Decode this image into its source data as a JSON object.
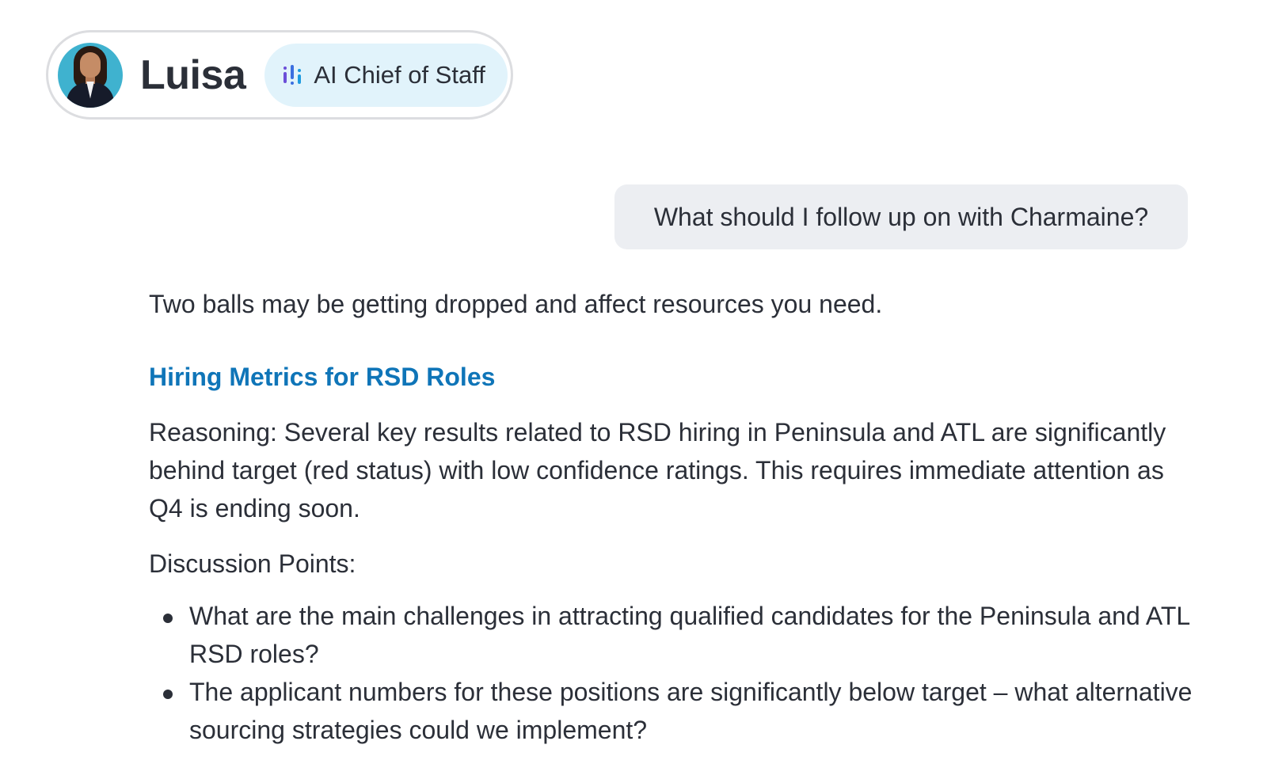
{
  "header": {
    "agent_name": "Luisa",
    "role_badge": "AI Chief of Staff",
    "role_icon": "signal-bars-icon",
    "avatar_alt": "Luisa avatar"
  },
  "conversation": {
    "user_message": "What should I follow up on with Charmaine?",
    "response": {
      "intro": "Two balls may be getting dropped and affect resources you need.",
      "section_title": "Hiring Metrics for RSD Roles",
      "reasoning": "Reasoning: Several key results related to RSD hiring in Peninsula and ATL are significantly behind target (red status) with low confidence ratings. This requires immediate attention as Q4 is ending soon.",
      "discussion_label": "Discussion Points:",
      "discussion_points": [
        "What are the main challenges in attracting qualified candidates for the Peninsula and ATL RSD roles?",
        "The applicant numbers for these positions are significantly below target – what alternative sourcing strategies could we implement?"
      ]
    }
  },
  "colors": {
    "accent_link": "#0f75b8",
    "badge_bg": "#e1f3fb",
    "bubble_bg": "#eceef2",
    "text": "#2b2f38"
  }
}
